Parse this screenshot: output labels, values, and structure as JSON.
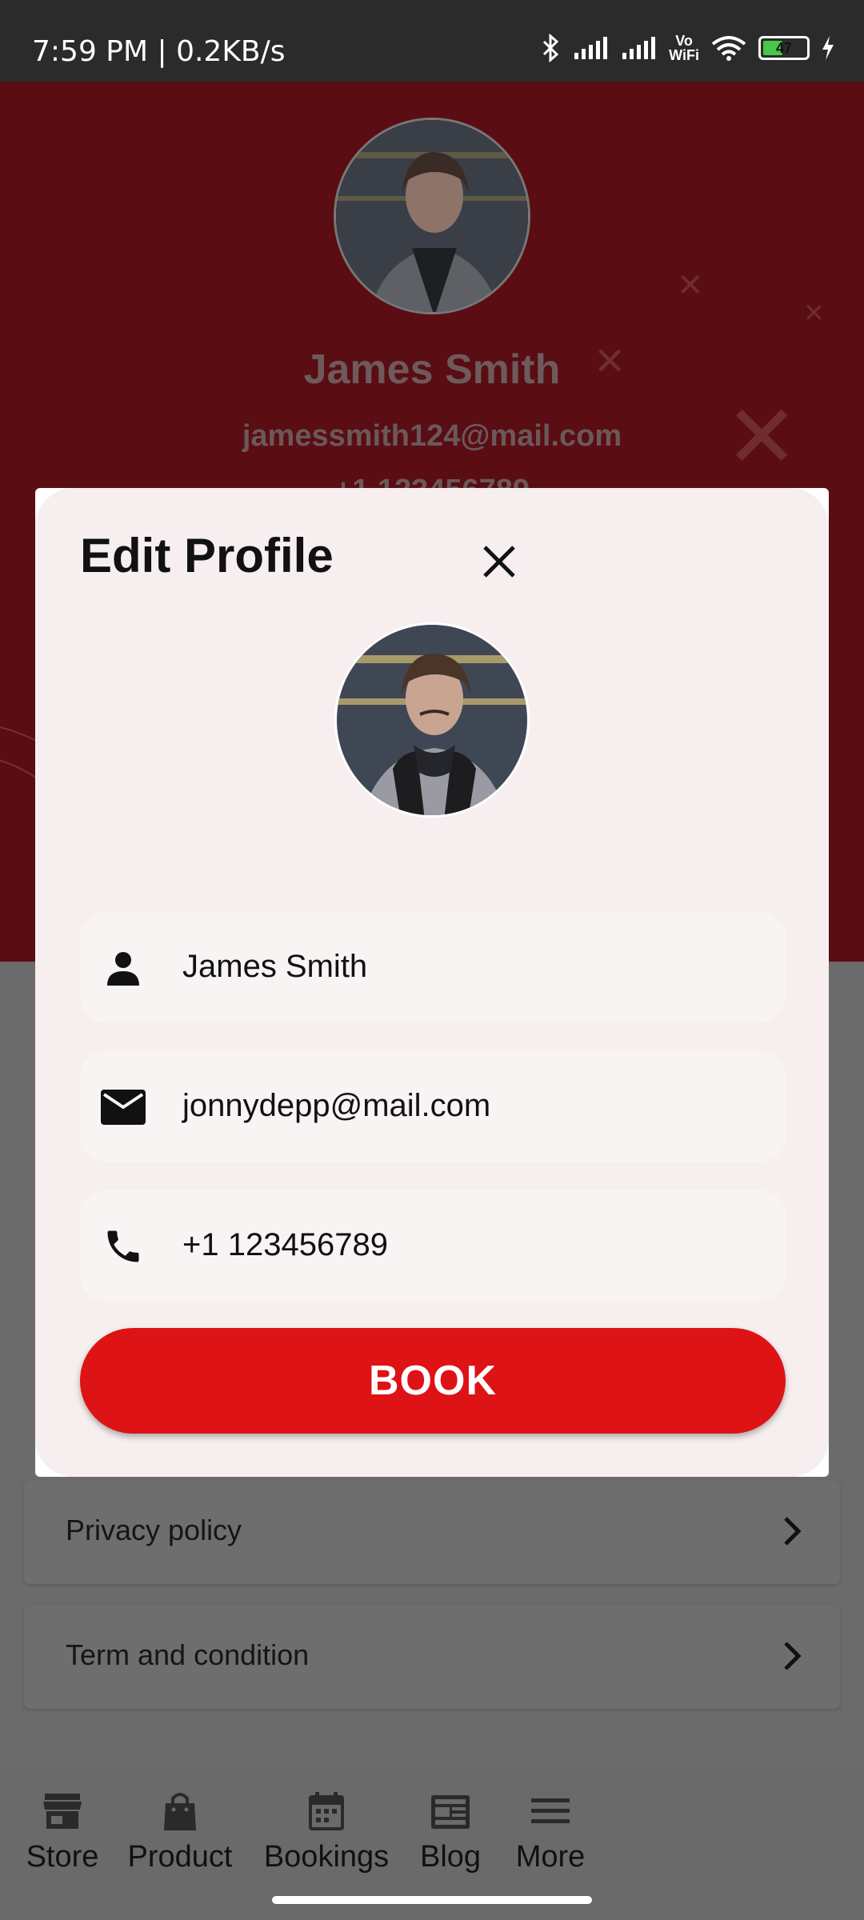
{
  "status_bar": {
    "time_text": "7:59 PM | 0.2KB/s",
    "battery_level": "47",
    "icons": [
      "bluetooth-icon",
      "signal-icon",
      "signal-icon",
      "vowifi-icon",
      "wifi-icon",
      "battery-icon",
      "charging-icon"
    ],
    "vowifi_top": "Vo",
    "vowifi_bottom": "WiFi"
  },
  "profile": {
    "name": "James Smith",
    "email": "jamessmith124@mail.com",
    "phone": "+1 123456789"
  },
  "settings_list": [
    {
      "label": "Privacy policy"
    },
    {
      "label": "Term and condition"
    }
  ],
  "bottom_nav": [
    {
      "label": "Store",
      "icon": "store-icon"
    },
    {
      "label": "Product",
      "icon": "shopping-bag-icon"
    },
    {
      "label": "Bookings",
      "icon": "calendar-icon"
    },
    {
      "label": "Blog",
      "icon": "newspaper-icon"
    },
    {
      "label": "More",
      "icon": "menu-icon"
    }
  ],
  "modal": {
    "title": "Edit Profile",
    "fields": {
      "name": "James Smith",
      "email": "jonnydepp@mail.com",
      "phone": "+1 123456789"
    },
    "submit_label": "BOOK"
  },
  "colors": {
    "header_bg": "#5a0d13",
    "accent": "#dd1316",
    "modal_bg": "#f7efef"
  }
}
